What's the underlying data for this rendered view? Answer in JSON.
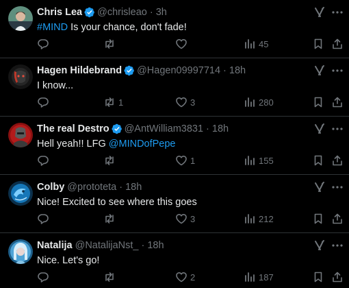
{
  "posts": [
    {
      "name": "Chris Lea",
      "handle": "@chrisleao",
      "separator": "·",
      "time": "3h",
      "text_link": "#MIND",
      "text": " Is your chance, don't fade!",
      "replies": "",
      "reposts": "",
      "likes": "",
      "views": "45",
      "avatar": "avatar-photo-man"
    },
    {
      "name": "Hagen Hildebrand",
      "handle": "@Hagen09997714",
      "separator": "·",
      "time": "18h",
      "text": "I know...",
      "replies": "",
      "reposts": "1",
      "likes": "3",
      "views": "280",
      "avatar": "avatar-dark-robot"
    },
    {
      "name": "The real Destro",
      "handle": "@AntWilliam3831",
      "separator": "·",
      "time": "18h",
      "text": "Hell yeah!! LFG ",
      "text_link": "@MINDofPepe",
      "replies": "",
      "reposts": "",
      "likes": "1",
      "views": "155",
      "avatar": "avatar-red-warrior"
    },
    {
      "name": "Colby",
      "handle": "@prototeta",
      "separator": "·",
      "time": "18h",
      "text": "Nice! Excited to see where this goes",
      "replies": "",
      "reposts": "",
      "likes": "3",
      "views": "212",
      "avatar": "avatar-blue-creature"
    },
    {
      "name": "Natalija",
      "handle": "@NatalijaNst_",
      "separator": "·",
      "time": "18h",
      "text": "Nice. Let's go!",
      "replies": "",
      "reposts": "",
      "likes": "2",
      "views": "187",
      "avatar": "avatar-blue-woman"
    }
  ],
  "colors": {
    "background": "#000000",
    "text": "#e7e9ea",
    "muted": "#71767b",
    "link": "#1d9bf0",
    "divider": "#2f3336"
  }
}
